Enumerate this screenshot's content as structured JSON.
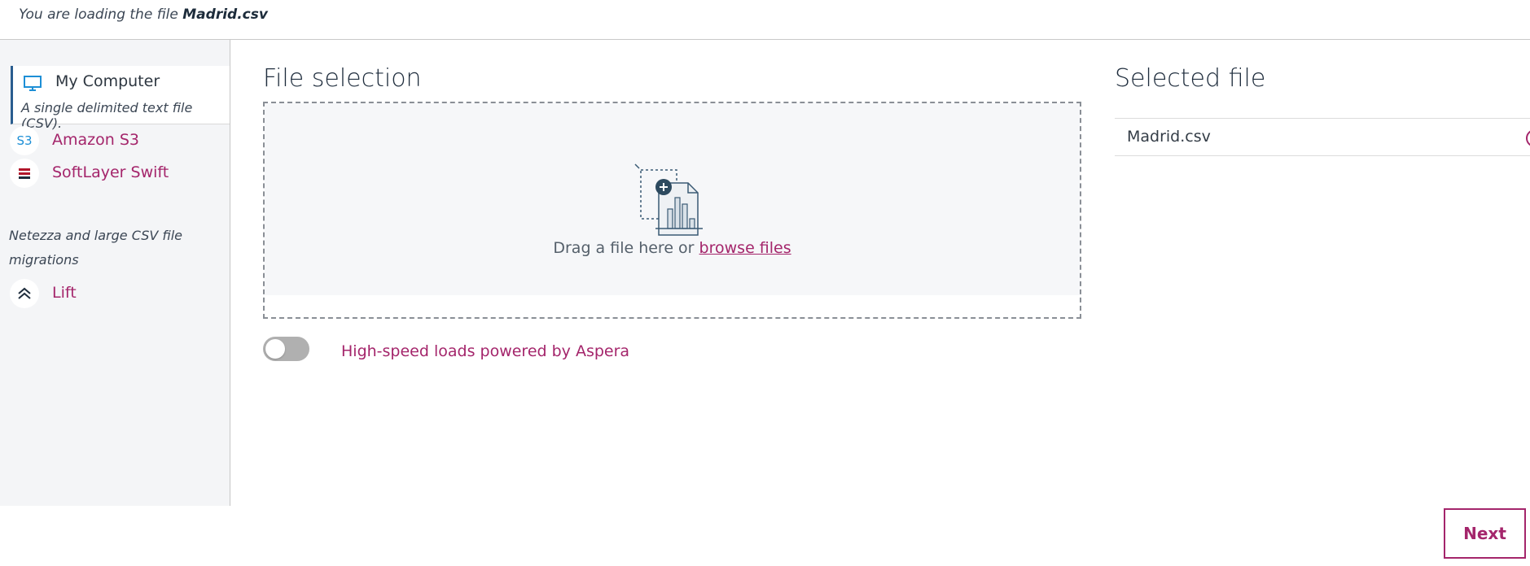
{
  "header": {
    "message_prefix": "You are loading the file",
    "file_name": "Madrid.csv"
  },
  "sidebar": {
    "selected": {
      "label": "My Computer",
      "description": "A single delimited text file (CSV).",
      "icon": "monitor-icon"
    },
    "items": [
      {
        "label": "Amazon S3",
        "icon_text": "S3",
        "icon": "s3-icon"
      },
      {
        "label": "SoftLayer Swift",
        "icon": "stack-icon"
      }
    ],
    "note": "Netezza and large CSV file migrations",
    "lift": {
      "label": "Lift",
      "icon": "chevron-up-icon"
    }
  },
  "file_selection": {
    "title": "File selection",
    "drop_text": "Drag a file here or",
    "browse_link": "browse files"
  },
  "aspera": {
    "label": "High-speed loads powered by Aspera",
    "enabled": false
  },
  "selected_file": {
    "title": "Selected file",
    "name": "Madrid.csv"
  },
  "actions": {
    "next_label": "Next"
  },
  "colors": {
    "accent": "#a4256b",
    "icon_blue": "#1d8fd6",
    "text_dark": "#1f2d3d"
  }
}
